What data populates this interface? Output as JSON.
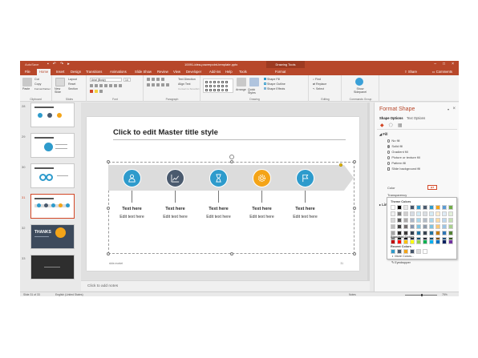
{
  "titlebar": {
    "autosave": "AutoSave",
    "doc_title": "10091-idea-powerpoint-template.pptx",
    "context_tab": "Drawing Tools",
    "user": "",
    "qat_icons": [
      "save-icon",
      "undo-icon",
      "redo-icon",
      "start-from-beginning-icon"
    ]
  },
  "menu": {
    "tabs": [
      "File",
      "Home",
      "Insert",
      "Design",
      "Transitions",
      "Animations",
      "Slide Show",
      "Review",
      "View",
      "Developer",
      "Add-ins",
      "Help",
      "Tools",
      "Format"
    ],
    "active": "Home",
    "share": "Share",
    "comments": "Comments"
  },
  "ribbon": {
    "clipboard": {
      "paste": "Paste",
      "cut": "Cut",
      "copy": "Copy",
      "format_painter": "Format Painter",
      "label": "Clipboard"
    },
    "slides": {
      "new_slide": "New Slide",
      "layout": "Layout",
      "reset": "Reset",
      "section": "Section",
      "label": "Slides"
    },
    "font": {
      "name": "Arial (Body)",
      "size": "14",
      "label": "Font"
    },
    "paragraph": {
      "text_direction": "Text Direction",
      "align_text": "Align Text",
      "smartart": "Convert to SmartArt",
      "label": "Paragraph"
    },
    "drawing": {
      "arrange": "Arrange",
      "quick_styles": "Quick Styles",
      "shape_fill": "Shape Fill",
      "shape_outline": "Shape Outline",
      "shape_effects": "Shape Effects",
      "label": "Drawing"
    },
    "editing": {
      "find": "Find",
      "replace": "Replace",
      "select": "Select",
      "label": "Editing"
    },
    "commands": {
      "show_sidepanel": "Show Sidepanel",
      "label": "Commands Group"
    }
  },
  "thumbnails": [
    {
      "num": "28",
      "style": "light",
      "active": false
    },
    {
      "num": "29",
      "style": "light",
      "active": false
    },
    {
      "num": "30",
      "style": "light",
      "active": false
    },
    {
      "num": "31",
      "style": "light",
      "active": true
    },
    {
      "num": "32",
      "style": "dark",
      "active": false,
      "text": "THANKS"
    },
    {
      "num": "33",
      "style": "darker",
      "active": false
    }
  ],
  "slide": {
    "title": "Click to edit Master title style",
    "footer_left": "slide.market",
    "footer_right": "31",
    "steps": [
      {
        "here": "Text here",
        "edit": "Edit text here",
        "color": "#2e9bcc",
        "icon": "person-icon"
      },
      {
        "here": "Text here",
        "edit": "Edit text here",
        "color": "#4a5a6e",
        "icon": "chart-icon"
      },
      {
        "here": "Text here",
        "edit": "Edit text here",
        "color": "#2e9bcc",
        "icon": "hourglass-icon"
      },
      {
        "here": "Text here",
        "edit": "Edit text here",
        "color": "#f4a418",
        "icon": "gear-icon"
      },
      {
        "here": "Text here",
        "edit": "Edit text here",
        "color": "#2e9bcc",
        "icon": "flag-icon"
      }
    ],
    "band_color": "#dcdcdc"
  },
  "notes": {
    "placeholder": "Click to add notes"
  },
  "format_pane": {
    "title": "Format Shape",
    "tabs": [
      "Shape Options",
      "Text Options"
    ],
    "active_tab": "Shape Options",
    "fill_section": "Fill",
    "fill_options": [
      {
        "label": "No fill",
        "type": "radio",
        "on": false
      },
      {
        "label": "Solid fill",
        "type": "radio",
        "on": true
      },
      {
        "label": "Gradient fill",
        "type": "radio",
        "on": false
      },
      {
        "label": "Picture or texture fill",
        "type": "radio",
        "on": false
      },
      {
        "label": "Pattern fill",
        "type": "radio",
        "on": false
      },
      {
        "label": "Slide background fill",
        "type": "check",
        "on": false
      }
    ],
    "color_label": "Color",
    "transparency_label": "Transparency",
    "line_section": "Line"
  },
  "color_popup": {
    "theme_heading": "Theme Colors",
    "standard_heading": "Standard Colors",
    "recent_heading": "Recent Colors",
    "more_colors": "More Colors...",
    "eyedropper": "Eyedropper",
    "theme_top": [
      "#ffffff",
      "#000000",
      "#e7e6e6",
      "#44546a",
      "#2e9bcc",
      "#4a5a6e",
      "#2e9bcc",
      "#f4a418",
      "#5b9bd5",
      "#70ad47"
    ],
    "theme_shades": [
      [
        "#f2f2f2",
        "#7f7f7f",
        "#d0cece",
        "#d6dce4",
        "#d4ebf5",
        "#d9dde2",
        "#d4ebf5",
        "#fdedd1",
        "#deebf6",
        "#e2efd9"
      ],
      [
        "#d8d8d8",
        "#595959",
        "#aeabab",
        "#adb9ca",
        "#a9d7eb",
        "#b3bcc6",
        "#a9d7eb",
        "#fbdba3",
        "#bdd7ee",
        "#c5e0b3"
      ],
      [
        "#bfbfbf",
        "#3f3f3f",
        "#757070",
        "#8496b0",
        "#7ec3e0",
        "#8e9aa9",
        "#7ec3e0",
        "#f9c975",
        "#9cc3e5",
        "#a8d08d"
      ],
      [
        "#a5a5a5",
        "#262626",
        "#3a3838",
        "#323f4f",
        "#2274a0",
        "#37434f",
        "#2274a0",
        "#c27b0c",
        "#2e75b5",
        "#538135"
      ],
      [
        "#7f7f7f",
        "#0c0c0c",
        "#171616",
        "#222a35",
        "#164d6a",
        "#242d35",
        "#164d6a",
        "#815208",
        "#1e4e79",
        "#375623"
      ]
    ],
    "standard": [
      "#c00000",
      "#ff0000",
      "#ffc000",
      "#ffff00",
      "#92d050",
      "#00b050",
      "#00b0f0",
      "#0070c0",
      "#002060",
      "#7030a0"
    ],
    "recent": [
      "#2e9bcc",
      "#4a5a6e",
      "#f4a418",
      "#44546a",
      "#dcdcdc",
      "#ffffff"
    ]
  },
  "status": {
    "slide_info": "Slide 31 of 33",
    "language": "English (United States)",
    "notes": "Notes",
    "zoom": "75%"
  }
}
